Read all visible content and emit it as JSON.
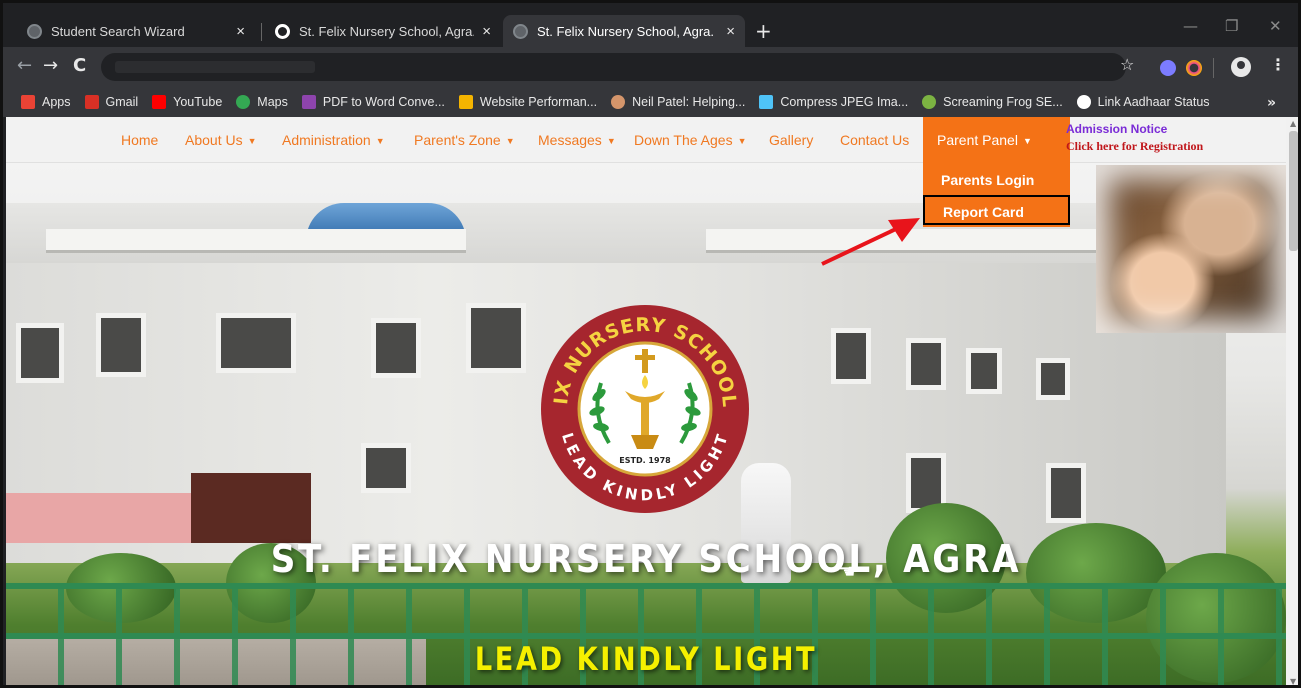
{
  "browser": {
    "tabs": [
      {
        "title": "Student Search Wizard",
        "active": false
      },
      {
        "title": "St. Felix Nursery School, Agra.",
        "active": true
      },
      {
        "title": "St. Felix Nursery School, Agra.",
        "active": false
      }
    ],
    "tab_close": "×",
    "new_tab": "+",
    "window_controls": {
      "minimize": "—",
      "restore": "❐",
      "close": "✕"
    },
    "nav": {
      "back": "←",
      "forward": "→",
      "reload": "C"
    },
    "star": "☆",
    "menu": "⋮",
    "bookmarks": [
      {
        "label": "Apps",
        "icon": "apps-grid-icon",
        "color": "#ea4335"
      },
      {
        "label": "Gmail",
        "icon": "gmail-icon",
        "color": "#d93025"
      },
      {
        "label": "YouTube",
        "icon": "youtube-icon",
        "color": "#ff0000"
      },
      {
        "label": "Maps",
        "icon": "maps-pin-icon",
        "color": "#34a853"
      },
      {
        "label": "PDF to Word Conve...",
        "icon": "pdf-icon",
        "color": "#8e44ad"
      },
      {
        "label": "Website Performan...",
        "icon": "performance-icon",
        "color": "#f4b400"
      },
      {
        "label": "Neil Patel: Helping...",
        "icon": "avatar-icon",
        "color": "#d4956b"
      },
      {
        "label": "Compress JPEG Ima...",
        "icon": "compress-icon",
        "color": "#4fc3f7"
      },
      {
        "label": "Screaming Frog SE...",
        "icon": "frog-icon",
        "color": "#7cb342"
      },
      {
        "label": "Link Aadhaar Status",
        "icon": "globe-e-icon",
        "color": "#ffffff"
      }
    ],
    "bookmarks_more": "»"
  },
  "site": {
    "nav": [
      {
        "label": "Home",
        "caret": false
      },
      {
        "label": "About Us",
        "caret": true
      },
      {
        "label": "Administration",
        "caret": true
      },
      {
        "label": "Parent's Zone",
        "caret": true
      },
      {
        "label": "Messages",
        "caret": true
      },
      {
        "label": "Down The Ages",
        "caret": true
      },
      {
        "label": "Gallery",
        "caret": false
      },
      {
        "label": "Contact Us",
        "caret": false
      },
      {
        "label": "Parent Panel",
        "caret": true,
        "active": true
      }
    ],
    "caret": "▼",
    "admission": {
      "title": "Admission Notice",
      "link": "Click here for Registration"
    },
    "dropdown": [
      {
        "label": "Parents Login"
      },
      {
        "label": "Report Card",
        "highlighted": true
      }
    ],
    "emblem": {
      "ring_text_top": "ST. FELIX NURSERY SCHOOL, AGRA",
      "ring_text_bottom": "LEAD KINDLY LIGHT",
      "estd": "ESTD. 1978"
    },
    "headline": "ST. FELIX NURSERY SCHOOL, AGRA",
    "motto": "LEAD KINDLY LIGHT"
  },
  "colors": {
    "accent": "#f47216",
    "nav_text": "#f07922",
    "admission_title": "#7a2bd6",
    "admission_link": "#c0161b",
    "arrow": "#e8141b",
    "emblem_ring": "#a6262e",
    "motto": "#f5f000"
  }
}
